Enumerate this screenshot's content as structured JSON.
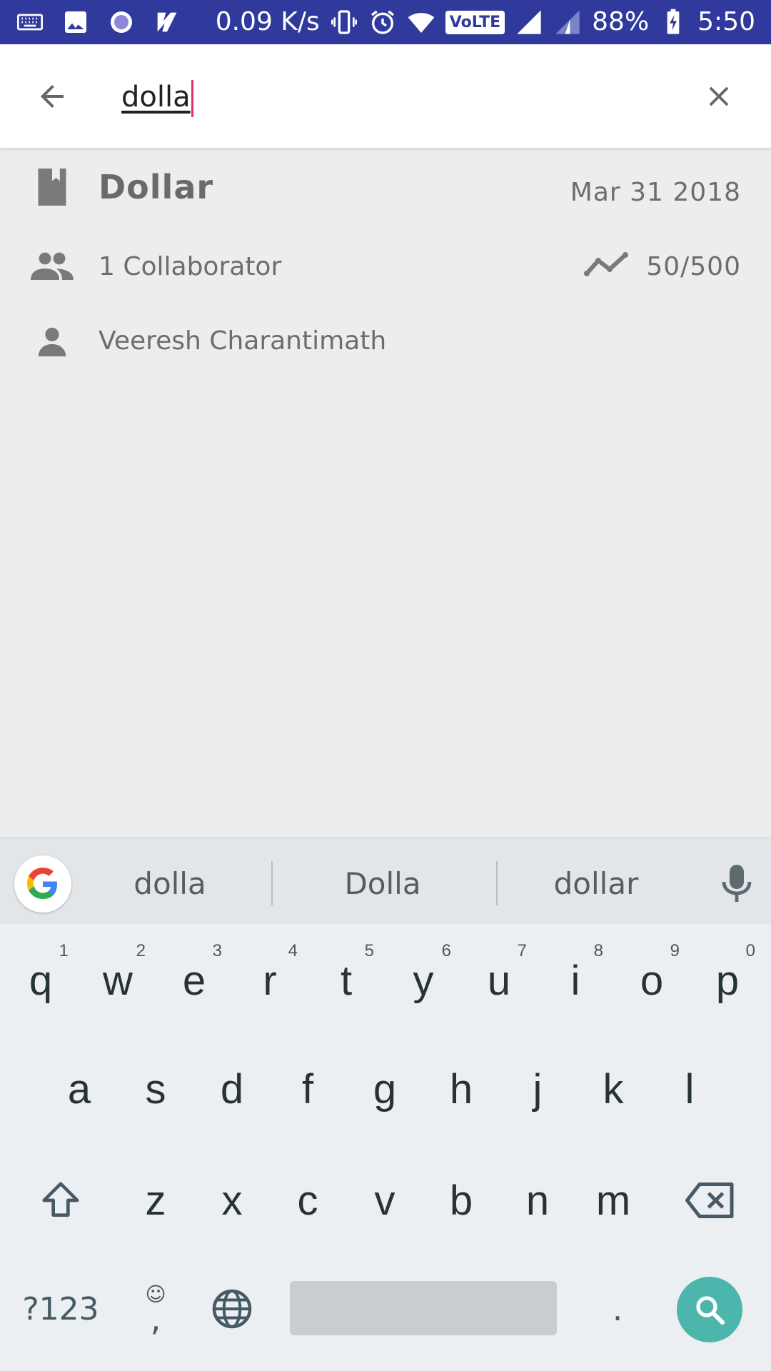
{
  "status_bar": {
    "network_speed": "0.09 K/s",
    "volte": "VoLTE",
    "battery": "88%",
    "time": "5:50"
  },
  "search": {
    "query": "dolla"
  },
  "result": {
    "title": "Dollar",
    "date": "Mar 31 2018",
    "collaborators": "1 Collaborator",
    "progress": "50/500",
    "owner": "Veeresh Charantimath"
  },
  "keyboard": {
    "suggestions": [
      "dolla",
      "Dolla",
      "dollar"
    ],
    "row1": [
      {
        "key": "q",
        "hint": "1"
      },
      {
        "key": "w",
        "hint": "2"
      },
      {
        "key": "e",
        "hint": "3"
      },
      {
        "key": "r",
        "hint": "4"
      },
      {
        "key": "t",
        "hint": "5"
      },
      {
        "key": "y",
        "hint": "6"
      },
      {
        "key": "u",
        "hint": "7"
      },
      {
        "key": "i",
        "hint": "8"
      },
      {
        "key": "o",
        "hint": "9"
      },
      {
        "key": "p",
        "hint": "0"
      }
    ],
    "row2": [
      "a",
      "s",
      "d",
      "f",
      "g",
      "h",
      "j",
      "k",
      "l"
    ],
    "row3": [
      "z",
      "x",
      "c",
      "v",
      "b",
      "n",
      "m"
    ],
    "symbols_label": "?123",
    "comma_label": ",",
    "period_label": "."
  },
  "colors": {
    "status_bar": "#303a9c",
    "accent_caret": "#e2306c",
    "search_key": "#4db6ac"
  }
}
